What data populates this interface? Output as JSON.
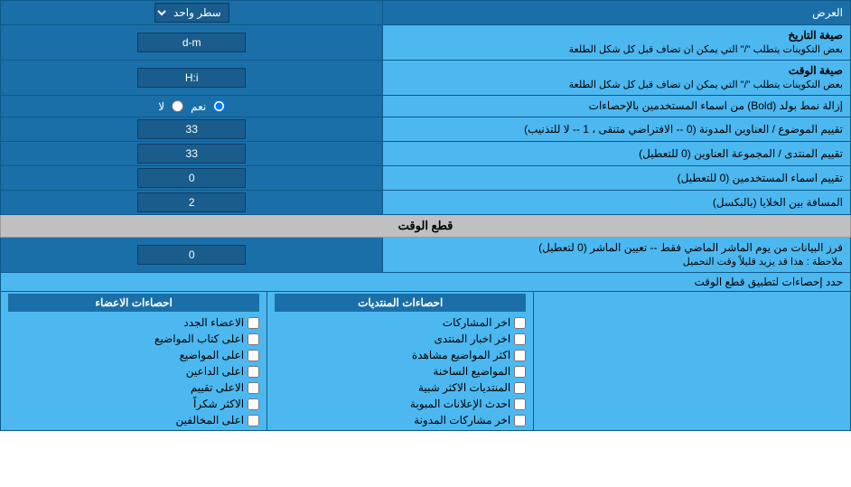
{
  "header": {
    "display_label": "العرض",
    "dropdown_label": "سطر واحد"
  },
  "rows": [
    {
      "id": "date_format",
      "label": "صيغة التاريخ",
      "sublabel": "بعض التكوينات يتطلب \"/\" التي يمكن ان تضاف قبل كل شكل الطلعة",
      "value": "d-m"
    },
    {
      "id": "time_format",
      "label": "صيغة الوقت",
      "sublabel": "بعض التكوينات يتطلب \"/\" التي يمكن ان تضاف قبل كل شكل الطلعة",
      "value": "H:i"
    },
    {
      "id": "bold_remove",
      "label": "إزالة نمط بولد (Bold) من اسماء المستخدمين بالإحصاءات",
      "sublabel": "",
      "type": "radio",
      "options": [
        "نعم",
        "لا"
      ],
      "selected": "نعم"
    },
    {
      "id": "topic_sort",
      "label": "تقييم الموضوع / العناوين المدونة (0 -- الافتراضي متنقى ، 1 -- لا للتذنيب)",
      "sublabel": "",
      "value": "33"
    },
    {
      "id": "forum_sort",
      "label": "تقييم المنتدى / المجموعة العناوين (0 للتعطيل)",
      "sublabel": "",
      "value": "33"
    },
    {
      "id": "user_names",
      "label": "تقييم اسماء المستخدمين (0 للتعطيل)",
      "sublabel": "",
      "value": "0"
    },
    {
      "id": "cell_spacing",
      "label": "المسافة بين الخلايا (بالبكسل)",
      "sublabel": "",
      "value": "2"
    }
  ],
  "section_cutoff": {
    "title": "قطع الوقت",
    "row": {
      "label": "فرز البيانات من يوم الماشر الماضي فقط -- تعيين الماشر (0 لتعطيل)",
      "note": "ملاحظة : هذا قد يزيد قليلاً وقت التحميل",
      "value": "0"
    }
  },
  "stats_section": {
    "limit_label": "حدد إحصاءات لتطبيق قطع الوقت",
    "col_posts": {
      "title": "احصاءات المنتديات",
      "items": [
        "اخر المشاركات",
        "اخر اخبار المنتدى",
        "اكثر المواضيع مشاهدة",
        "المواضيع الساخنة",
        "المنتديات الاكثر شبية",
        "احدث الإعلانات المبوبة",
        "اخر مشاركات المدونة"
      ]
    },
    "col_members": {
      "title": "احصاءات الاعضاء",
      "items": [
        "الاعضاء الجدد",
        "اعلى كتاب المواضيع",
        "اعلى المواضيع",
        "اعلى الداعين",
        "الاعلى تقييم",
        "الاكثر شكراً",
        "اعلى المخالفين"
      ]
    }
  },
  "colors": {
    "dark_blue": "#1a6fa8",
    "light_blue": "#4db8f0",
    "medium_blue": "#1a5c8c",
    "border": "#0d5a8a"
  }
}
